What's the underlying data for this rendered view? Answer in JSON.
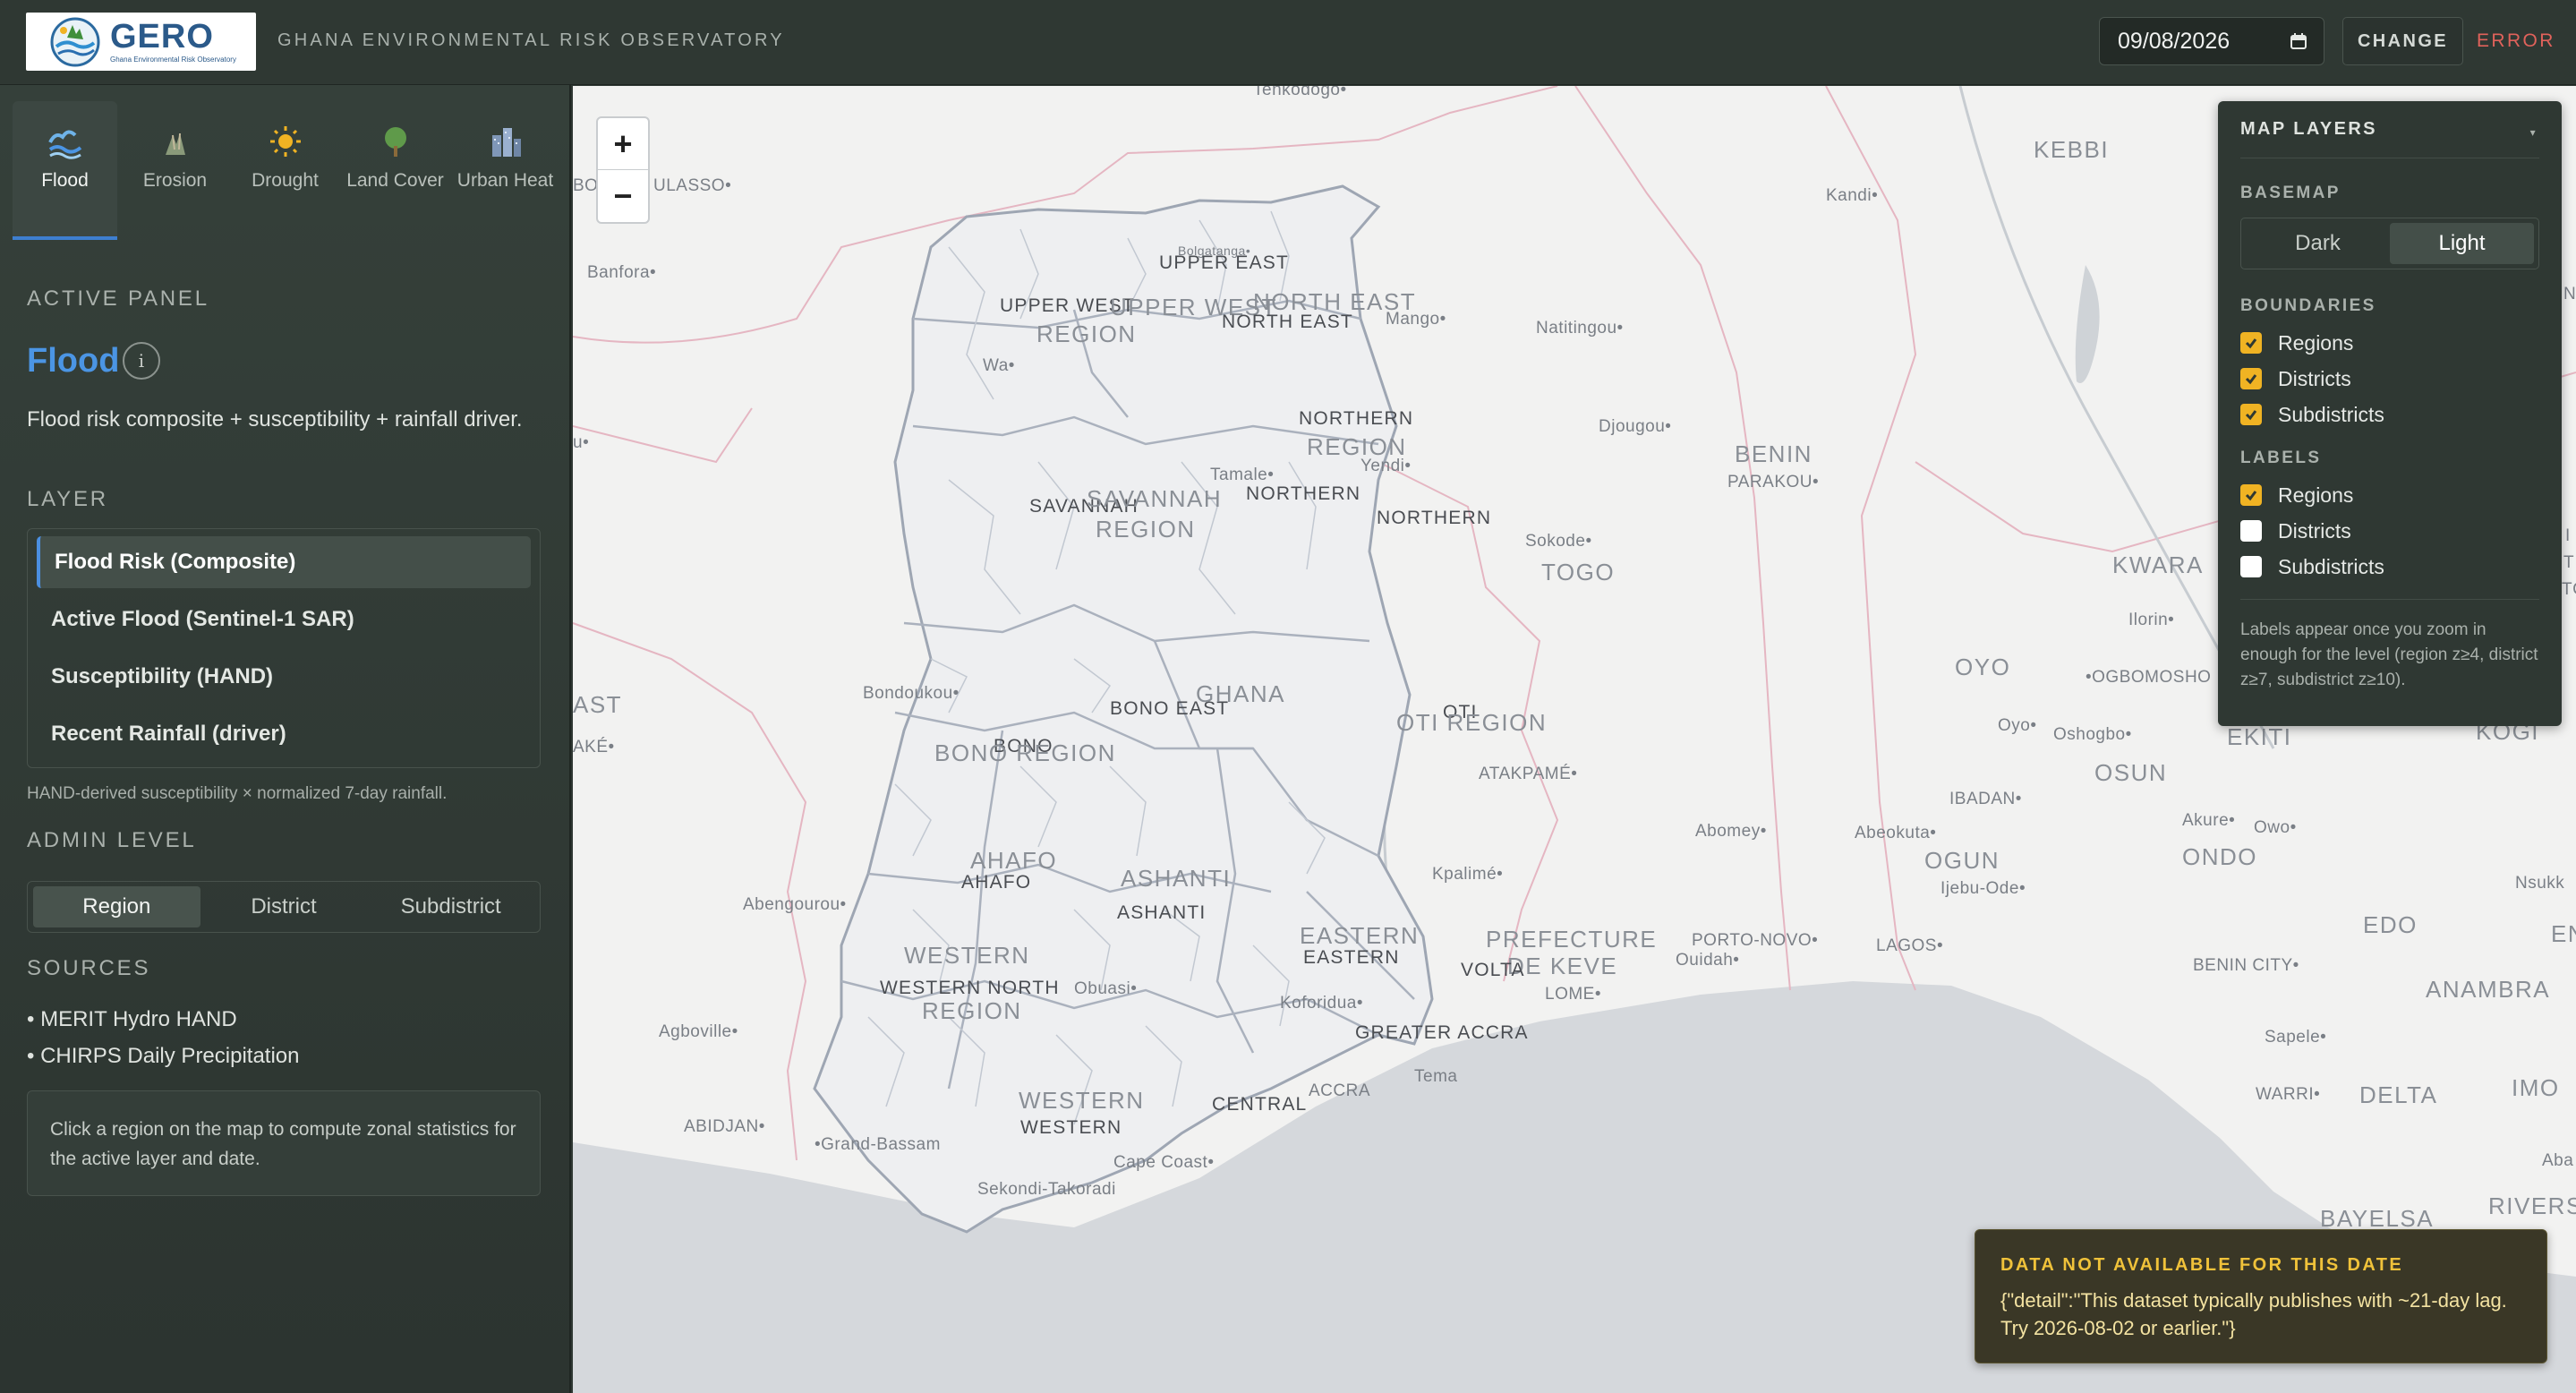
{
  "header": {
    "logo_text": "GERO",
    "logo_subtitle": "Ghana Environmental Risk Observatory",
    "app_title": "GHANA ENVIRONMENTAL RISK OBSERVATORY",
    "date_value": "09/08/2026",
    "change_label": "CHANGE",
    "status_text": "ERROR"
  },
  "tabs": [
    {
      "label": "Flood",
      "icon": "wave-icon",
      "active": true
    },
    {
      "label": "Erosion",
      "icon": "erosion-icon",
      "active": false
    },
    {
      "label": "Drought",
      "icon": "sun-icon",
      "active": false
    },
    {
      "label": "Land Cover",
      "icon": "tree-icon",
      "active": false
    },
    {
      "label": "Urban Heat",
      "icon": "buildings-icon",
      "active": false
    }
  ],
  "panel": {
    "section_label": "ACTIVE PANEL",
    "title": "Flood",
    "info_glyph": "i",
    "description": "Flood risk composite + susceptibility + rainfall driver.",
    "layer_label": "LAYER",
    "layers": [
      {
        "label": "Flood Risk (Composite)",
        "active": true
      },
      {
        "label": "Active Flood (Sentinel-1 SAR)",
        "active": false
      },
      {
        "label": "Susceptibility (HAND)",
        "active": false
      },
      {
        "label": "Recent Rainfall (driver)",
        "active": false
      }
    ],
    "layer_note": "HAND-derived susceptibility × normalized 7-day rainfall.",
    "admin_label": "ADMIN LEVEL",
    "admin_levels": [
      "Region",
      "District",
      "Subdistrict"
    ],
    "admin_selected": "Region",
    "sources_label": "SOURCES",
    "sources": [
      "• MERIT Hydro HAND",
      "• CHIRPS Daily Precipitation"
    ],
    "hint": "Click a region on the map to compute zonal statistics for the active layer and date."
  },
  "map": {
    "zoom_in": "+",
    "zoom_out": "−",
    "labels": [
      {
        "text": "Tenkodogo•",
        "kind": "city"
      },
      {
        "text": "KEBBI",
        "kind": "big"
      },
      {
        "text": "Kandi•",
        "kind": "city"
      },
      {
        "text": "BO",
        "kind": "city"
      },
      {
        "text": "ULASSO•",
        "kind": "city"
      },
      {
        "text": "Banfora•",
        "kind": "city"
      },
      {
        "text": "Bolgatanga•",
        "kind": "city"
      },
      {
        "text": "UPPER EAST",
        "kind": "region"
      },
      {
        "text": "UPPER WEST",
        "kind": "region"
      },
      {
        "text": "UPPER WEST",
        "kind": "big"
      },
      {
        "text": "REGION",
        "kind": "big"
      },
      {
        "text": "NORTH EAST",
        "kind": "big"
      },
      {
        "text": "NORTH EAST",
        "kind": "region"
      },
      {
        "text": "Mango•",
        "kind": "city"
      },
      {
        "text": "Natitingou•",
        "kind": "city"
      },
      {
        "text": "Wa•",
        "kind": "city"
      },
      {
        "text": "NORTHERN",
        "kind": "region"
      },
      {
        "text": "REGION",
        "kind": "big"
      },
      {
        "text": "Djougou•",
        "kind": "city"
      },
      {
        "text": "BENIN",
        "kind": "big"
      },
      {
        "text": "PARAKOU•",
        "kind": "city"
      },
      {
        "text": "Yendi•",
        "kind": "city"
      },
      {
        "text": "Tamale•",
        "kind": "city"
      },
      {
        "text": "NORTHERN",
        "kind": "region"
      },
      {
        "text": "SAVANNAH",
        "kind": "region"
      },
      {
        "text": "SAVANNAH",
        "kind": "big"
      },
      {
        "text": "REGION",
        "kind": "big"
      },
      {
        "text": "NORTHERN",
        "kind": "region"
      },
      {
        "text": "Sokode•",
        "kind": "city"
      },
      {
        "text": "TOGO",
        "kind": "big"
      },
      {
        "text": "KWARA",
        "kind": "big"
      },
      {
        "text": "Ilorin•",
        "kind": "city"
      },
      {
        "text": "OYO",
        "kind": "big"
      },
      {
        "text": "•OGBOMOSHO",
        "kind": "city"
      },
      {
        "text": "Bondoukou•",
        "kind": "city"
      },
      {
        "text": "AST",
        "kind": "big"
      },
      {
        "text": "BONO EAST",
        "kind": "region"
      },
      {
        "text": "GHANA",
        "kind": "big"
      },
      {
        "text": "OTI",
        "kind": "region"
      },
      {
        "text": "OTI REGION",
        "kind": "big"
      },
      {
        "text": "AKÉ•",
        "kind": "city"
      },
      {
        "text": "BONO",
        "kind": "region"
      },
      {
        "text": "BONO REGION",
        "kind": "big"
      },
      {
        "text": "ATAKPAMÉ•",
        "kind": "city"
      },
      {
        "text": "Oyo•",
        "kind": "city"
      },
      {
        "text": "Oshogbo•",
        "kind": "city"
      },
      {
        "text": "EKITI",
        "kind": "big"
      },
      {
        "text": "OSUN",
        "kind": "big"
      },
      {
        "text": "KOGI",
        "kind": "big"
      },
      {
        "text": "IBADAN•",
        "kind": "city"
      },
      {
        "text": "Akure•",
        "kind": "city"
      },
      {
        "text": "Owo•",
        "kind": "city"
      },
      {
        "text": "Abomey•",
        "kind": "city"
      },
      {
        "text": "Abeokuta•",
        "kind": "city"
      },
      {
        "text": "OGUN",
        "kind": "big"
      },
      {
        "text": "ONDO",
        "kind": "big"
      },
      {
        "text": "Ijebu-Ode•",
        "kind": "city"
      },
      {
        "text": "AHAFO",
        "kind": "big"
      },
      {
        "text": "AHAFO",
        "kind": "region"
      },
      {
        "text": "ASHANTI",
        "kind": "big"
      },
      {
        "text": "ASHANTI",
        "kind": "region"
      },
      {
        "text": "Kpalimé•",
        "kind": "city"
      },
      {
        "text": "Abengourou•",
        "kind": "city"
      },
      {
        "text": "Nsukk",
        "kind": "city"
      },
      {
        "text": "EASTERN",
        "kind": "big"
      },
      {
        "text": "EASTERN",
        "kind": "region"
      },
      {
        "text": "PREFECTURE",
        "kind": "big"
      },
      {
        "text": "DE KEVE",
        "kind": "big"
      },
      {
        "text": "PORTO-NOVO•",
        "kind": "city"
      },
      {
        "text": "Ouidah•",
        "kind": "city"
      },
      {
        "text": "LAGOS•",
        "kind": "city"
      },
      {
        "text": "EDO",
        "kind": "big"
      },
      {
        "text": "EN",
        "kind": "big"
      },
      {
        "text": "WESTERN",
        "kind": "big"
      },
      {
        "text": "WESTERN NORTH",
        "kind": "region"
      },
      {
        "text": "REGION",
        "kind": "big"
      },
      {
        "text": "Obuasi•",
        "kind": "city"
      },
      {
        "text": "VOLTA",
        "kind": "region"
      },
      {
        "text": "LOME•",
        "kind": "city"
      },
      {
        "text": "BENIN CITY•",
        "kind": "city"
      },
      {
        "text": "ANAMBRA",
        "kind": "big"
      },
      {
        "text": "Koforidua•",
        "kind": "city"
      },
      {
        "text": "Agboville•",
        "kind": "city"
      },
      {
        "text": "GREATER ACCRA",
        "kind": "region"
      },
      {
        "text": "Sapele•",
        "kind": "city"
      },
      {
        "text": "Tema",
        "kind": "city"
      },
      {
        "text": "ACCRA",
        "kind": "city"
      },
      {
        "text": "WESTERN",
        "kind": "big"
      },
      {
        "text": "CENTRAL",
        "kind": "region"
      },
      {
        "text": "WESTERN",
        "kind": "region"
      },
      {
        "text": "WARRI•",
        "kind": "city"
      },
      {
        "text": "DELTA",
        "kind": "big"
      },
      {
        "text": "IMO",
        "kind": "big"
      },
      {
        "text": "ABIDJAN•",
        "kind": "city"
      },
      {
        "text": "•Grand-Bassam",
        "kind": "city"
      },
      {
        "text": "Cape Coast•",
        "kind": "city"
      },
      {
        "text": "Sekondi-Takoradi",
        "kind": "city"
      },
      {
        "text": "Aba",
        "kind": "city"
      },
      {
        "text": "BAYELSA",
        "kind": "big"
      },
      {
        "text": "RIVERS",
        "kind": "big"
      },
      {
        "text": "u•",
        "kind": "city"
      },
      {
        "text": "N",
        "kind": "city"
      },
      {
        "text": "I",
        "kind": "city"
      },
      {
        "text": "T",
        "kind": "city"
      },
      {
        "text": "TC",
        "kind": "city"
      }
    ]
  },
  "layers_panel": {
    "title": "MAP LAYERS",
    "caret": "▾",
    "basemap_label": "BASEMAP",
    "basemap_options": [
      "Dark",
      "Light"
    ],
    "basemap_selected": "Light",
    "boundaries_label": "BOUNDARIES",
    "boundaries": [
      {
        "label": "Regions",
        "checked": true
      },
      {
        "label": "Districts",
        "checked": true
      },
      {
        "label": "Subdistricts",
        "checked": true
      }
    ],
    "labels_label": "LABELS",
    "labels": [
      {
        "label": "Regions",
        "checked": true
      },
      {
        "label": "Districts",
        "checked": false
      },
      {
        "label": "Subdistricts",
        "checked": false
      }
    ],
    "note": "Labels appear once you zoom in enough for the level (region z≥4, district z≥7, subdistrict z≥10)."
  },
  "toast": {
    "title": "DATA NOT AVAILABLE FOR THIS DATE",
    "body": "{\"detail\":\"This dataset typically publishes with ~21-day lag. Try 2026-08-02 or earlier.\"}"
  },
  "colors": {
    "accent_blue": "#4b95e4",
    "error_red": "#e0625b",
    "checkbox_on": "#f0b323",
    "toast_title": "#f0c23a"
  }
}
